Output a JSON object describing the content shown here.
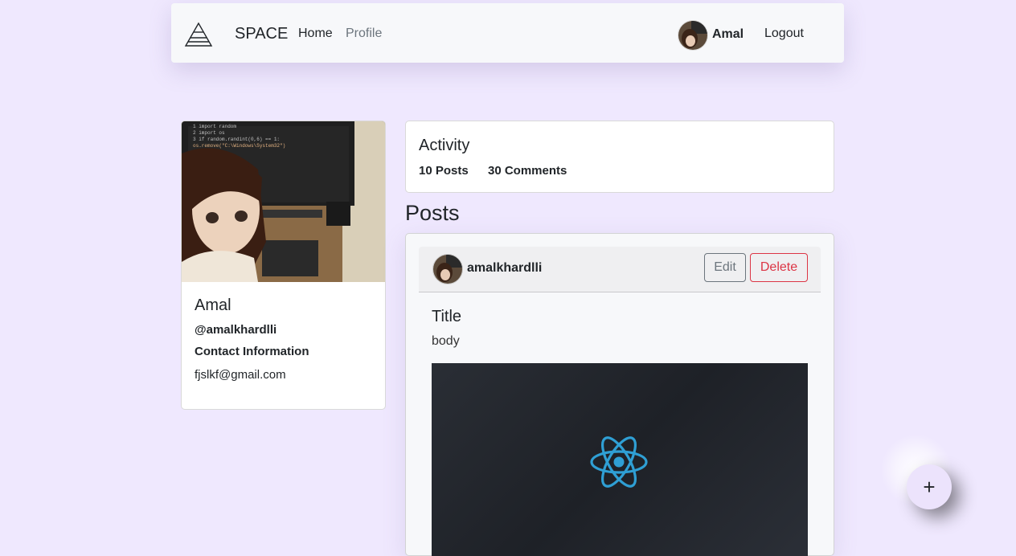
{
  "navbar": {
    "brand": "SPACE",
    "links": [
      {
        "label": "Home"
      },
      {
        "label": "Profile"
      }
    ],
    "user_name": "Amal",
    "logout_label": "Logout"
  },
  "profile": {
    "name": "Amal",
    "handle": "@amalkhardlli",
    "contact_label": "Contact Information",
    "email": "fjslkf@gmail.com"
  },
  "activity": {
    "title": "Activity",
    "posts_count": "10 Posts",
    "comments_count": "30 Comments"
  },
  "posts_heading": "Posts",
  "posts": [
    {
      "author": "amalkhardlli",
      "edit_label": "Edit",
      "delete_label": "Delete",
      "title": "Title",
      "body": "body"
    }
  ],
  "fab_label": "+",
  "colors": {
    "background": "#efe8fe",
    "delete": "#dc3545",
    "edit": "#6c757d",
    "react": "#2f9fd4"
  }
}
